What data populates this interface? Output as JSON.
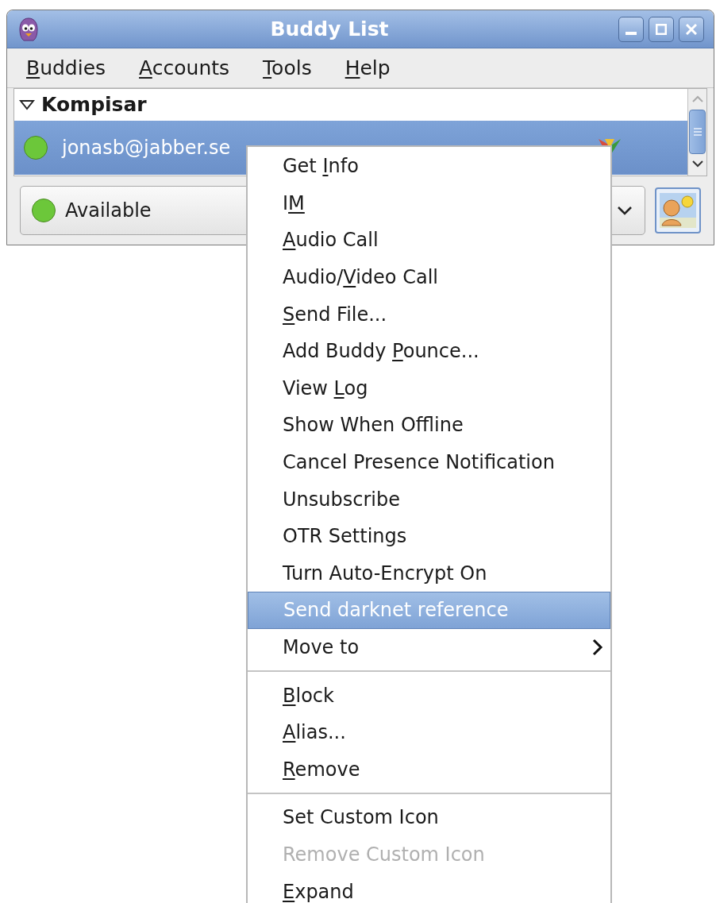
{
  "window": {
    "title": "Buddy List"
  },
  "menubar": [
    {
      "label": [
        {
          "text": "B",
          "underline": true
        },
        {
          "text": "uddies",
          "underline": false
        }
      ]
    },
    {
      "label": [
        {
          "text": "A",
          "underline": true
        },
        {
          "text": "ccounts",
          "underline": false
        }
      ]
    },
    {
      "label": [
        {
          "text": "T",
          "underline": true
        },
        {
          "text": "ools",
          "underline": false
        }
      ]
    },
    {
      "label": [
        {
          "text": "H",
          "underline": true
        },
        {
          "text": "elp",
          "underline": false
        }
      ]
    }
  ],
  "groups": [
    {
      "name": "Kompisar",
      "expanded": true,
      "buddies": [
        {
          "name": "jonasb@jabber.se",
          "selected": true,
          "color": "#6cc73a"
        }
      ]
    }
  ],
  "status": {
    "label": "Available",
    "color": "#6cc73a"
  },
  "context_menu": [
    {
      "kind": "item",
      "label": [
        {
          "text": "Get ",
          "underline": false
        },
        {
          "text": "I",
          "underline": true
        },
        {
          "text": "nfo",
          "underline": false
        }
      ],
      "selected": false,
      "disabled": false
    },
    {
      "kind": "item",
      "label": [
        {
          "text": "I",
          "underline": false
        },
        {
          "text": "M",
          "underline": true
        }
      ],
      "selected": false,
      "disabled": false
    },
    {
      "kind": "item",
      "label": [
        {
          "text": "A",
          "underline": true
        },
        {
          "text": "udio Call",
          "underline": false
        }
      ],
      "selected": false,
      "disabled": false
    },
    {
      "kind": "item",
      "label": [
        {
          "text": "Audio/",
          "underline": false
        },
        {
          "text": "V",
          "underline": true
        },
        {
          "text": "ideo Call",
          "underline": false
        }
      ],
      "selected": false,
      "disabled": false
    },
    {
      "kind": "item",
      "label": [
        {
          "text": "S",
          "underline": true
        },
        {
          "text": "end File...",
          "underline": false
        }
      ],
      "selected": false,
      "disabled": false
    },
    {
      "kind": "item",
      "label": [
        {
          "text": "Add Buddy ",
          "underline": false
        },
        {
          "text": "P",
          "underline": true
        },
        {
          "text": "ounce...",
          "underline": false
        }
      ],
      "selected": false,
      "disabled": false
    },
    {
      "kind": "item",
      "label": [
        {
          "text": "View ",
          "underline": false
        },
        {
          "text": "L",
          "underline": true
        },
        {
          "text": "og",
          "underline": false
        }
      ],
      "selected": false,
      "disabled": false
    },
    {
      "kind": "item",
      "label": [
        {
          "text": "Show When Offline",
          "underline": false
        }
      ],
      "selected": false,
      "disabled": false
    },
    {
      "kind": "item",
      "label": [
        {
          "text": "Cancel Presence Notification",
          "underline": false
        }
      ],
      "selected": false,
      "disabled": false
    },
    {
      "kind": "item",
      "label": [
        {
          "text": "Unsubscribe",
          "underline": false
        }
      ],
      "selected": false,
      "disabled": false
    },
    {
      "kind": "item",
      "label": [
        {
          "text": "OTR Settings",
          "underline": false
        }
      ],
      "selected": false,
      "disabled": false
    },
    {
      "kind": "item",
      "label": [
        {
          "text": "Turn Auto-Encrypt On",
          "underline": false
        }
      ],
      "selected": false,
      "disabled": false
    },
    {
      "kind": "item",
      "label": [
        {
          "text": "Send darknet reference",
          "underline": false
        }
      ],
      "selected": true,
      "disabled": false
    },
    {
      "kind": "submenu",
      "label": [
        {
          "text": "Move to",
          "underline": false
        }
      ],
      "selected": false,
      "disabled": false
    },
    {
      "kind": "separator"
    },
    {
      "kind": "item",
      "label": [
        {
          "text": "B",
          "underline": true
        },
        {
          "text": "lock",
          "underline": false
        }
      ],
      "selected": false,
      "disabled": false
    },
    {
      "kind": "item",
      "label": [
        {
          "text": "A",
          "underline": true
        },
        {
          "text": "lias...",
          "underline": false
        }
      ],
      "selected": false,
      "disabled": false
    },
    {
      "kind": "item",
      "label": [
        {
          "text": "R",
          "underline": true
        },
        {
          "text": "emove",
          "underline": false
        }
      ],
      "selected": false,
      "disabled": false
    },
    {
      "kind": "separator"
    },
    {
      "kind": "item",
      "label": [
        {
          "text": "Set Custom Icon",
          "underline": false
        }
      ],
      "selected": false,
      "disabled": false
    },
    {
      "kind": "item",
      "label": [
        {
          "text": "Remove Custom Icon",
          "underline": false
        }
      ],
      "selected": false,
      "disabled": true
    },
    {
      "kind": "item",
      "label": [
        {
          "text": "E",
          "underline": true
        },
        {
          "text": "xpand",
          "underline": false
        }
      ],
      "selected": false,
      "disabled": false
    }
  ]
}
